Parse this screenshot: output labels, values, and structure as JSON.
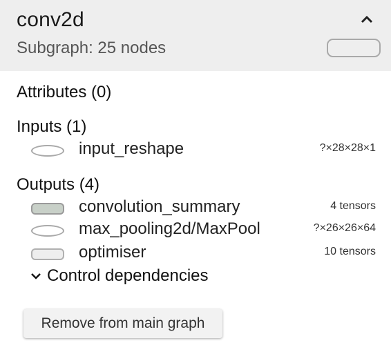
{
  "header": {
    "title": "conv2d",
    "subtitle": "Subgraph: 25 nodes"
  },
  "attributes": {
    "title": "Attributes (0)"
  },
  "inputs": {
    "title": "Inputs (1)",
    "items": [
      {
        "name": "input_reshape",
        "meta": "?×28×28×1",
        "shape": "ellipse"
      }
    ]
  },
  "outputs": {
    "title": "Outputs (4)",
    "items": [
      {
        "name": "convolution_summary",
        "meta": "4 tensors",
        "shape": "rect-dark"
      },
      {
        "name": "max_pooling2d/MaxPool",
        "meta": "?×26×26×64",
        "shape": "ellipse"
      },
      {
        "name": "optimiser",
        "meta": "10 tensors",
        "shape": "rect-light"
      }
    ],
    "control_dependencies_label": "Control dependencies"
  },
  "actions": {
    "remove_label": "Remove from main graph"
  },
  "icons": {
    "collapse": "chevron-up-icon",
    "expand_control": "chevron-down-icon"
  }
}
